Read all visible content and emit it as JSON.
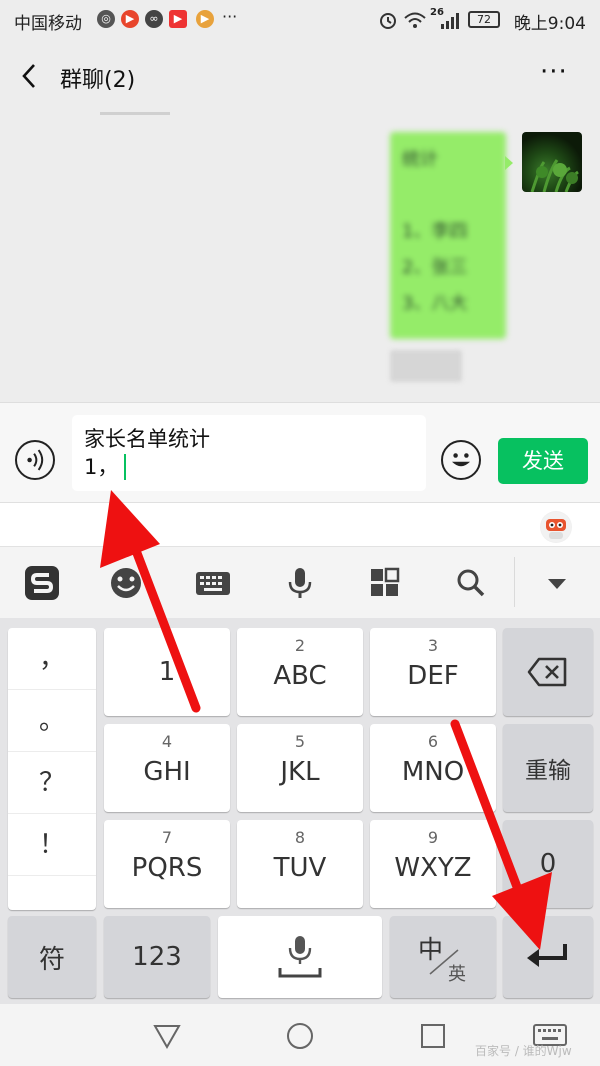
{
  "status_bar": {
    "carrier": "中国移动",
    "signal_label": "26",
    "battery": "72",
    "time": "晚上9:04",
    "more": "···"
  },
  "header": {
    "title": "群聊(2)",
    "more_label": "···"
  },
  "chat": {
    "message_lines": [
      "统计",
      "",
      "1、李四",
      "2、张三",
      "3、八大"
    ]
  },
  "input": {
    "line1": "家长名单统计",
    "line2": "1，",
    "send_label": "发送"
  },
  "keyboard": {
    "punctuation": [
      "，",
      "。",
      "？",
      "！"
    ],
    "keys": [
      {
        "num": "",
        "label": "1"
      },
      {
        "num": "2",
        "label": "ABC"
      },
      {
        "num": "3",
        "label": "DEF"
      },
      {
        "num": "4",
        "label": "GHI"
      },
      {
        "num": "5",
        "label": "JKL"
      },
      {
        "num": "6",
        "label": "MNO"
      },
      {
        "num": "7",
        "label": "PQRS"
      },
      {
        "num": "8",
        "label": "TUV"
      },
      {
        "num": "9",
        "label": "WXYZ"
      }
    ],
    "reinput_label": "重输",
    "zero_label": "0",
    "symbol_label": "符",
    "num_mode_label": "123",
    "lang_main": "中",
    "lang_alt": "英"
  },
  "watermark": "百家号 / 谁的Wjw"
}
